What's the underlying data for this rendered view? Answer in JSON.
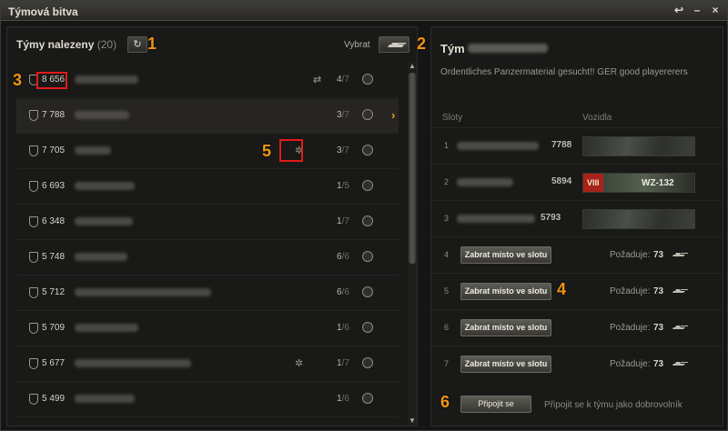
{
  "window": {
    "title": "Týmová bitva",
    "controls": [
      "↩",
      "–",
      "×"
    ]
  },
  "left": {
    "title": "Týmy nalezeny",
    "count": "(20)",
    "refresh_icon": "↻",
    "select_label": "Vybrat",
    "teams": [
      {
        "rating": "8 656",
        "players": "4",
        "max": "/7",
        "extra": "⇄",
        "selected": false
      },
      {
        "rating": "7 788",
        "players": "3",
        "max": "/7",
        "extra": "",
        "selected": true
      },
      {
        "rating": "7 705",
        "players": "3",
        "max": "/7",
        "extra": "✲",
        "selected": false
      },
      {
        "rating": "6 693",
        "players": "1",
        "max": "/5",
        "extra": "",
        "selected": false
      },
      {
        "rating": "6 348",
        "players": "1",
        "max": "/7",
        "extra": "",
        "selected": false
      },
      {
        "rating": "5 748",
        "players": "6",
        "max": "/6",
        "extra": "",
        "selected": false
      },
      {
        "rating": "5 712",
        "players": "6",
        "max": "/6",
        "extra": "",
        "selected": false
      },
      {
        "rating": "5 709",
        "players": "1",
        "max": "/6",
        "extra": "",
        "selected": false
      },
      {
        "rating": "5 677",
        "players": "1",
        "max": "/7",
        "extra": "✲",
        "selected": false
      },
      {
        "rating": "5 499",
        "players": "1",
        "max": "/6",
        "extra": "",
        "selected": false
      }
    ]
  },
  "right": {
    "team_title": "Tým",
    "description": "Ordentliches Panzermaterial gesucht!! GER good playererers",
    "col_slots": "Sloty",
    "col_vehicles": "Vozidla",
    "slots": [
      {
        "num": "1",
        "rating": "7788",
        "vehicle_tier": "",
        "vehicle_name": "",
        "occupied": true
      },
      {
        "num": "2",
        "rating": "5894",
        "vehicle_tier": "VIII",
        "vehicle_name": "WZ-132",
        "occupied": true
      },
      {
        "num": "3",
        "rating": "5793",
        "vehicle_tier": "",
        "vehicle_name": "",
        "occupied": true
      },
      {
        "num": "4",
        "take_label": "Zabrat místo ve slotu",
        "req_label": "Požaduje:",
        "req_value": "73",
        "occupied": false
      },
      {
        "num": "5",
        "take_label": "Zabrat místo ve slotu",
        "req_label": "Požaduje:",
        "req_value": "73",
        "occupied": false
      },
      {
        "num": "6",
        "take_label": "Zabrat místo ve slotu",
        "req_label": "Požaduje:",
        "req_value": "73",
        "occupied": false
      },
      {
        "num": "7",
        "take_label": "Zabrat místo ve slotu",
        "req_label": "Požaduje:",
        "req_value": "73",
        "occupied": false
      }
    ],
    "join_label": "Připojit se",
    "join_note": "Připojit se k týmu jako dobrovolník"
  },
  "callouts": [
    "1",
    "2",
    "3",
    "4",
    "5",
    "6"
  ],
  "colors": {
    "accent": "#f29511",
    "highlight": "#e21b1b",
    "arrow": "#f19a1a"
  }
}
